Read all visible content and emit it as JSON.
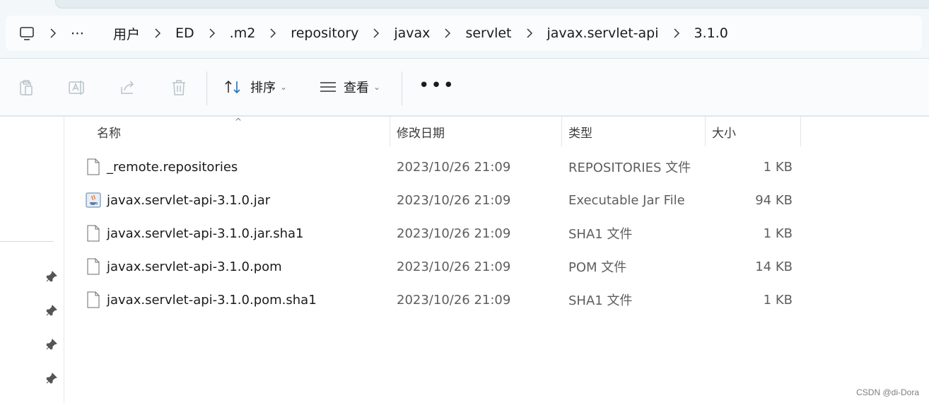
{
  "breadcrumb": {
    "more": "⋯",
    "items": [
      "用户",
      "ED",
      ".m2",
      "repository",
      "javax",
      "servlet",
      "javax.servlet-api",
      "3.1.0"
    ]
  },
  "toolbar": {
    "sort_label": "排序",
    "view_label": "查看",
    "more_label": "•••"
  },
  "columns": {
    "name": "名称",
    "date": "修改日期",
    "type": "类型",
    "size": "大小"
  },
  "files": [
    {
      "name": "_remote.repositories",
      "date": "2023/10/26 21:09",
      "type": "REPOSITORIES 文件",
      "size": "1 KB",
      "icon": "document-icon"
    },
    {
      "name": "javax.servlet-api-3.1.0.jar",
      "date": "2023/10/26 21:09",
      "type": "Executable Jar File",
      "size": "94 KB",
      "icon": "java-jar-icon"
    },
    {
      "name": "javax.servlet-api-3.1.0.jar.sha1",
      "date": "2023/10/26 21:09",
      "type": "SHA1 文件",
      "size": "1 KB",
      "icon": "document-icon"
    },
    {
      "name": "javax.servlet-api-3.1.0.pom",
      "date": "2023/10/26 21:09",
      "type": "POM 文件",
      "size": "14 KB",
      "icon": "document-icon"
    },
    {
      "name": "javax.servlet-api-3.1.0.pom.sha1",
      "date": "2023/10/26 21:09",
      "type": "SHA1 文件",
      "size": "1 KB",
      "icon": "document-icon"
    }
  ],
  "watermark": "CSDN @di-Dora"
}
